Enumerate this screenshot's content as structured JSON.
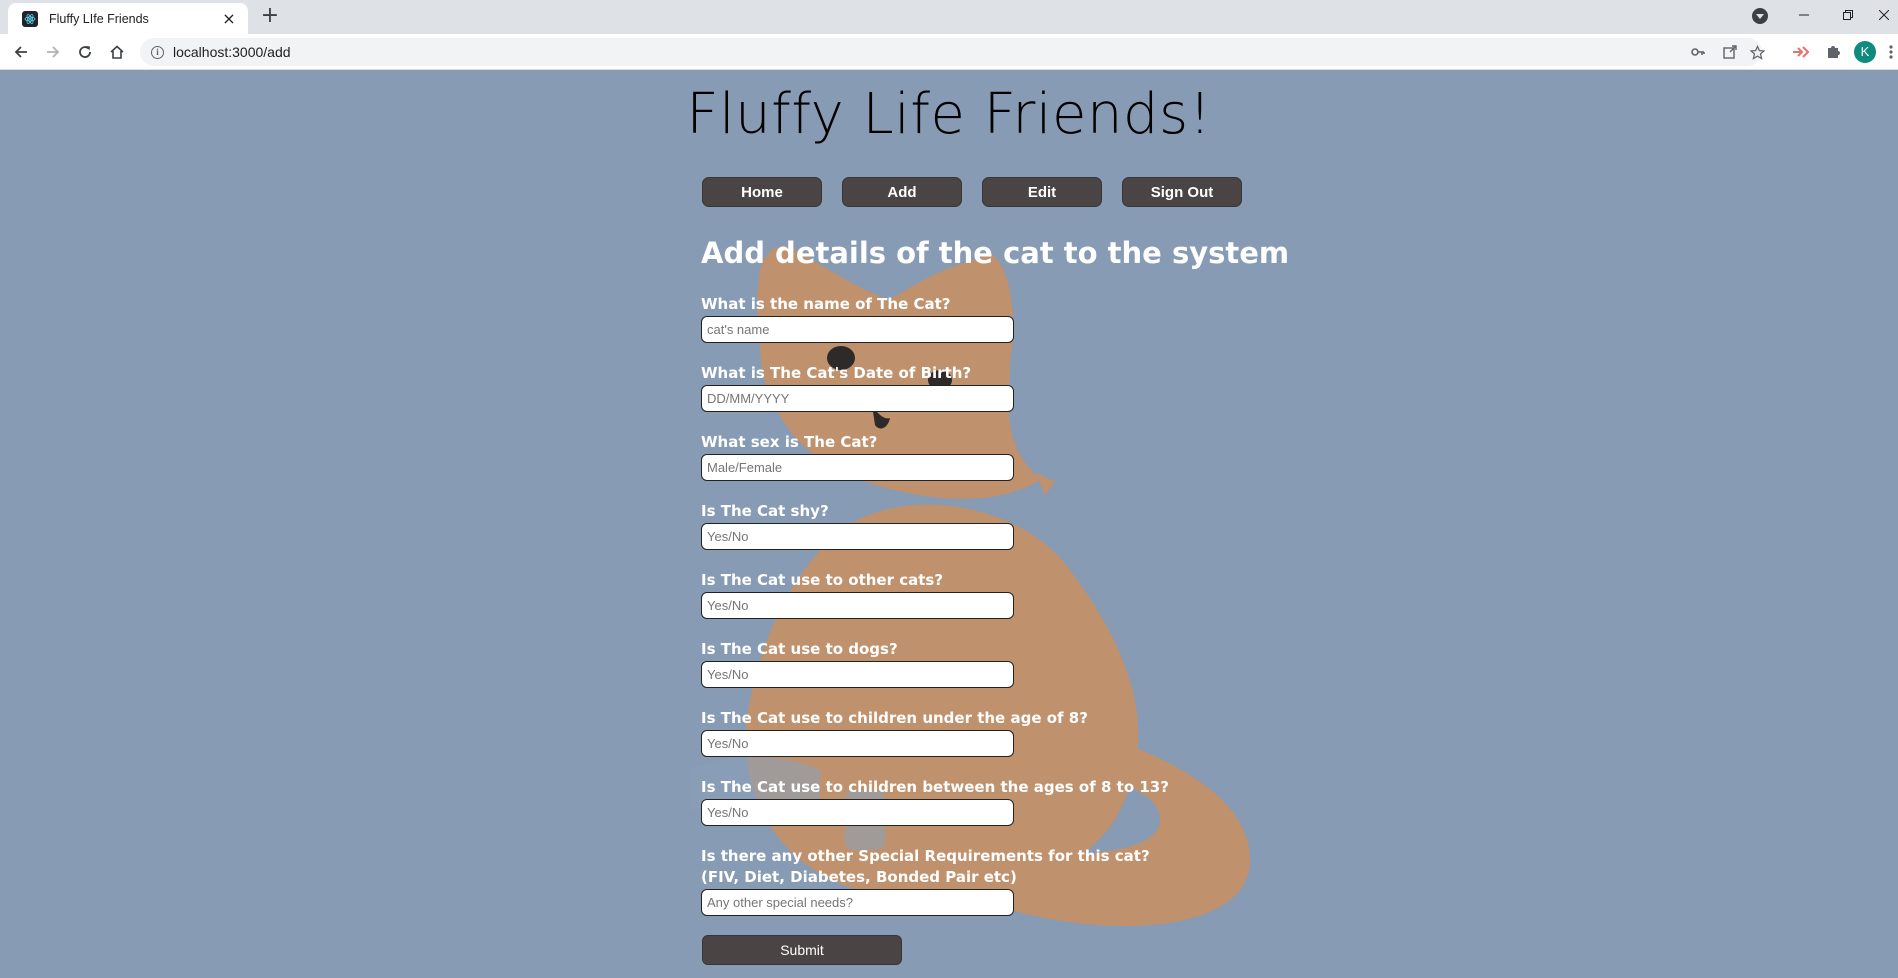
{
  "browser": {
    "tab_title": "Fluffy LIfe Friends",
    "tab_close": "×",
    "new_tab": "+",
    "url": "localhost:3000/add",
    "profile_initial": "K",
    "info_glyph": "i"
  },
  "site": {
    "title": "Fluffy Life Friends!"
  },
  "nav": {
    "items": [
      {
        "label": "Home"
      },
      {
        "label": "Add"
      },
      {
        "label": "Edit"
      },
      {
        "label": "Sign Out"
      }
    ]
  },
  "form": {
    "heading": "Add details of the cat to the system",
    "fields": [
      {
        "label": "What is the name of The Cat?",
        "placeholder": "cat's name",
        "value": ""
      },
      {
        "label": "What is The Cat's Date of Birth?",
        "placeholder": "DD/MM/YYYY",
        "value": ""
      },
      {
        "label": "What sex is The Cat?",
        "placeholder": "Male/Female",
        "value": ""
      },
      {
        "label": "Is The Cat shy?",
        "placeholder": "Yes/No",
        "value": ""
      },
      {
        "label": "Is The Cat use to other cats?",
        "placeholder": "Yes/No",
        "value": ""
      },
      {
        "label": "Is The Cat use to dogs?",
        "placeholder": "Yes/No",
        "value": ""
      },
      {
        "label": "Is The Cat use to children under the age of 8?",
        "placeholder": "Yes/No",
        "value": ""
      },
      {
        "label": "Is The Cat use to children between the ages of 8 to 13?",
        "placeholder": "Yes/No",
        "value": ""
      },
      {
        "label": "Is there any other Special Requirements for this cat? (FIV, Diet, Diabetes, Bonded Pair etc)",
        "placeholder": "Any other special needs?",
        "value": ""
      }
    ],
    "submit_label": "Submit"
  },
  "colors": {
    "page_background": "#879bb4",
    "button_background": "#4a4444",
    "cat_color": "#c0916d"
  }
}
